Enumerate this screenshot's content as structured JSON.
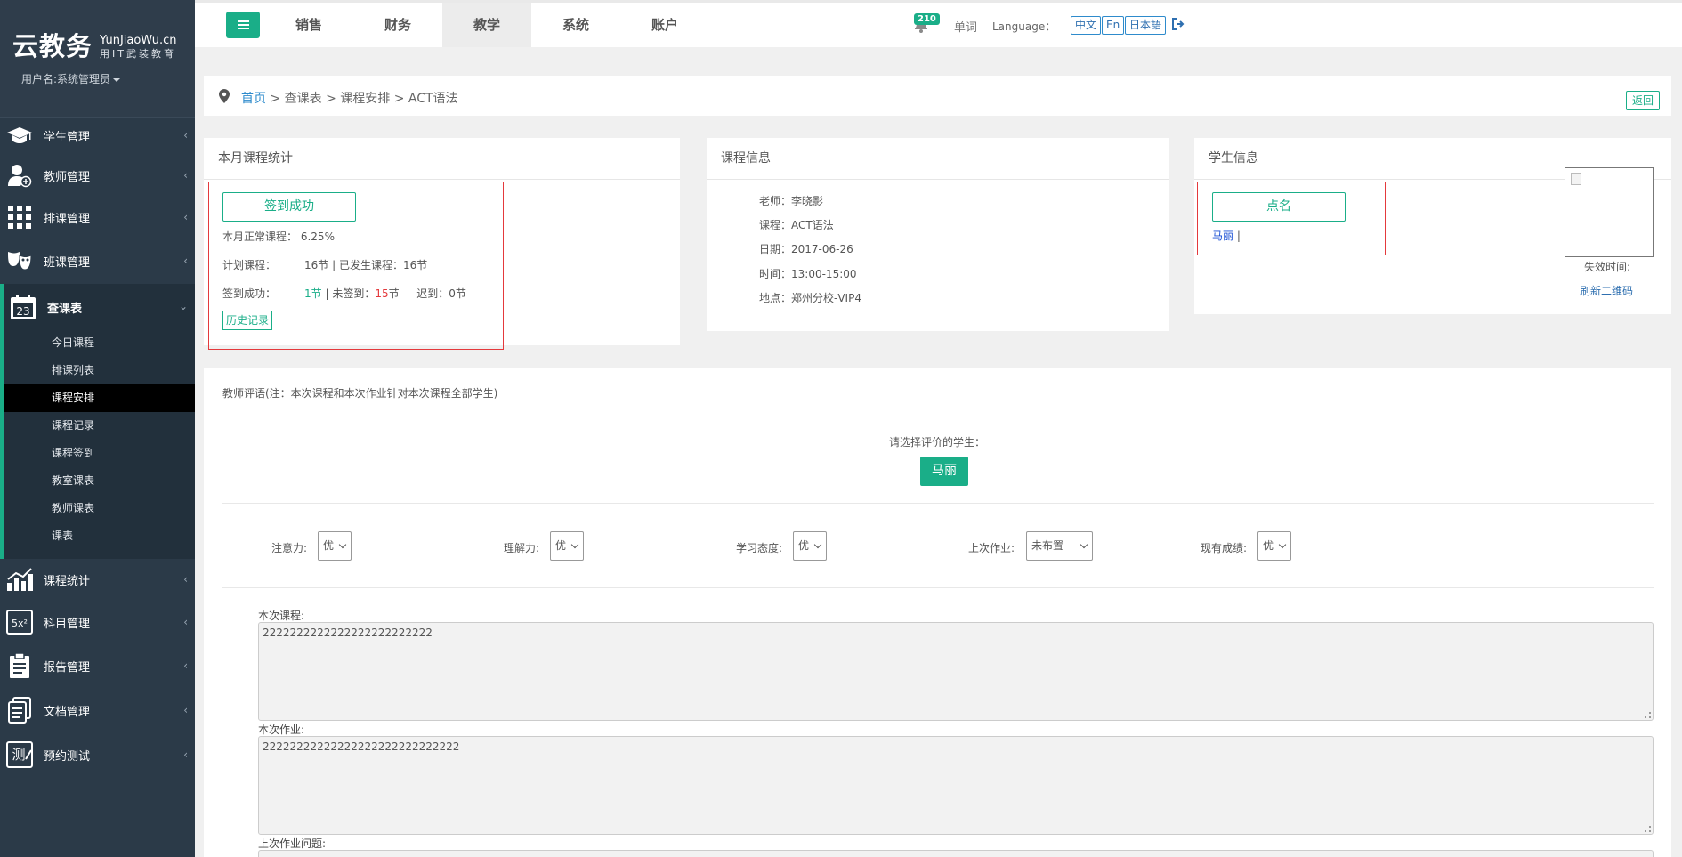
{
  "sidebar": {
    "logo_main": "云教务",
    "logo_en": "YunJiaoWu.cn",
    "logo_slogan": "用IT武装教育",
    "user_label": "用户名:系统管理员",
    "menu": [
      {
        "label": "学生管理",
        "icon": "graduation-cap-icon"
      },
      {
        "label": "教师管理",
        "icon": "teacher-icon"
      },
      {
        "label": "排课管理",
        "icon": "grid-icon"
      },
      {
        "label": "班课管理",
        "icon": "mask-icon"
      },
      {
        "label": "查课表",
        "icon": "calendar-icon",
        "calendar_day": "23"
      },
      {
        "label": "课程统计",
        "icon": "chart-icon"
      },
      {
        "label": "科目管理",
        "icon": "formula-icon"
      },
      {
        "label": "报告管理",
        "icon": "clipboard-icon"
      },
      {
        "label": "文档管理",
        "icon": "document-icon"
      },
      {
        "label": "预约测试",
        "icon": "test-icon",
        "icon_glyph": "测"
      }
    ],
    "submenu": [
      "今日课程",
      "排课列表",
      "课程安排",
      "课程记录",
      "课程签到",
      "教室课表",
      "教师课表",
      "课表"
    ],
    "submenu_active": "课程安排"
  },
  "topbar": {
    "tabs": [
      "销售",
      "财务",
      "教学",
      "系统",
      "账户"
    ],
    "active_tab": "教学",
    "notification_count": "210",
    "word": "单词",
    "language_label": "Language：",
    "languages": [
      "中文",
      "En",
      "日本語"
    ]
  },
  "breadcrumb": {
    "home": "首页",
    "path": " > 查课表 > 课程安排 > ACT语法",
    "back": "返回"
  },
  "stats_panel": {
    "title": "本月课程统计",
    "signed_button": "签到成功",
    "normal_label": "本月正常课程：",
    "normal_value": "6.25%",
    "planned_label": "计划课程：",
    "planned_value": "16节",
    "occurred_label": "已发生课程：",
    "occurred_value": "16节",
    "signed_label": "签到成功：",
    "signed_value": "1节",
    "unsigned_label": "未签到：",
    "unsigned_count": "15",
    "unsigned_unit": "节",
    "late_label": "迟到：",
    "late_value": "0节",
    "history_button": "历史记录"
  },
  "course_panel": {
    "title": "课程信息",
    "teacher_label": "老师：",
    "teacher": "李晓影",
    "course_label": "课程：",
    "course": "ACT语法",
    "date_label": "日期：",
    "date": "2017-06-26",
    "time_label": "时间：",
    "time": "13:00-15:00",
    "place_label": "地点：",
    "place": "郑州分校-VIP4"
  },
  "student_panel": {
    "title": "学生信息",
    "rollcall_button": "点名",
    "student": "马丽",
    "expire_label": "失效时间:",
    "refresh_qr": "刷新二维码"
  },
  "evaluation": {
    "title": "教师评语(注：本次课程和本次作业针对本次课程全部学生)",
    "pick_label": "请选择评价的学生：",
    "student_button": "马丽",
    "fields": [
      {
        "label": "注意力:",
        "value": "优"
      },
      {
        "label": "理解力:",
        "value": "优"
      },
      {
        "label": "学习态度:",
        "value": "优"
      },
      {
        "label": "上次作业:",
        "value": "未布置"
      },
      {
        "label": "现有成绩:",
        "value": "优"
      }
    ],
    "this_course_label": "本次课程:",
    "this_course_value": "2222222222222222222222222",
    "this_homework_label": "本次作业:",
    "this_homework_value": "22222222222222222222222222222",
    "last_homework_label": "上次作业问题:"
  }
}
